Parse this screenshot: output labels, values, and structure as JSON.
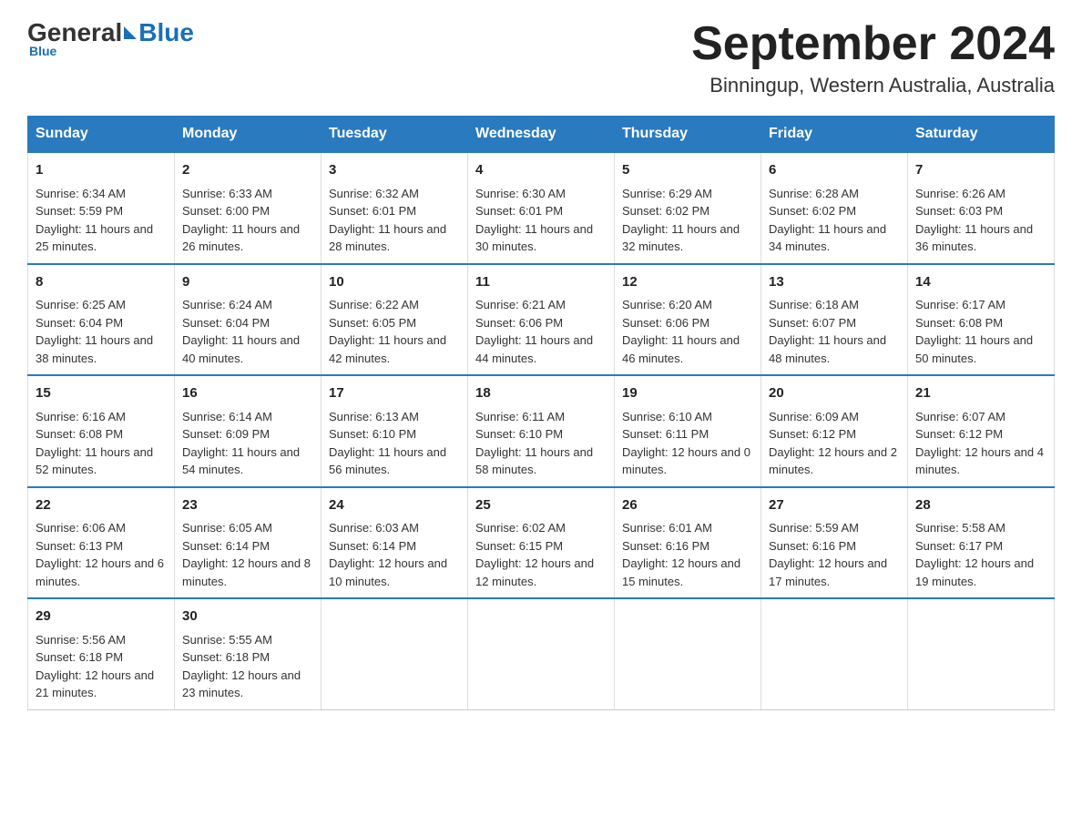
{
  "header": {
    "logo": {
      "general": "General",
      "blue": "Blue"
    },
    "title": "September 2024",
    "location": "Binningup, Western Australia, Australia"
  },
  "days_of_week": [
    "Sunday",
    "Monday",
    "Tuesday",
    "Wednesday",
    "Thursday",
    "Friday",
    "Saturday"
  ],
  "weeks": [
    [
      {
        "day": "1",
        "sunrise": "6:34 AM",
        "sunset": "5:59 PM",
        "daylight": "11 hours and 25 minutes."
      },
      {
        "day": "2",
        "sunrise": "6:33 AM",
        "sunset": "6:00 PM",
        "daylight": "11 hours and 26 minutes."
      },
      {
        "day": "3",
        "sunrise": "6:32 AM",
        "sunset": "6:01 PM",
        "daylight": "11 hours and 28 minutes."
      },
      {
        "day": "4",
        "sunrise": "6:30 AM",
        "sunset": "6:01 PM",
        "daylight": "11 hours and 30 minutes."
      },
      {
        "day": "5",
        "sunrise": "6:29 AM",
        "sunset": "6:02 PM",
        "daylight": "11 hours and 32 minutes."
      },
      {
        "day": "6",
        "sunrise": "6:28 AM",
        "sunset": "6:02 PM",
        "daylight": "11 hours and 34 minutes."
      },
      {
        "day": "7",
        "sunrise": "6:26 AM",
        "sunset": "6:03 PM",
        "daylight": "11 hours and 36 minutes."
      }
    ],
    [
      {
        "day": "8",
        "sunrise": "6:25 AM",
        "sunset": "6:04 PM",
        "daylight": "11 hours and 38 minutes."
      },
      {
        "day": "9",
        "sunrise": "6:24 AM",
        "sunset": "6:04 PM",
        "daylight": "11 hours and 40 minutes."
      },
      {
        "day": "10",
        "sunrise": "6:22 AM",
        "sunset": "6:05 PM",
        "daylight": "11 hours and 42 minutes."
      },
      {
        "day": "11",
        "sunrise": "6:21 AM",
        "sunset": "6:06 PM",
        "daylight": "11 hours and 44 minutes."
      },
      {
        "day": "12",
        "sunrise": "6:20 AM",
        "sunset": "6:06 PM",
        "daylight": "11 hours and 46 minutes."
      },
      {
        "day": "13",
        "sunrise": "6:18 AM",
        "sunset": "6:07 PM",
        "daylight": "11 hours and 48 minutes."
      },
      {
        "day": "14",
        "sunrise": "6:17 AM",
        "sunset": "6:08 PM",
        "daylight": "11 hours and 50 minutes."
      }
    ],
    [
      {
        "day": "15",
        "sunrise": "6:16 AM",
        "sunset": "6:08 PM",
        "daylight": "11 hours and 52 minutes."
      },
      {
        "day": "16",
        "sunrise": "6:14 AM",
        "sunset": "6:09 PM",
        "daylight": "11 hours and 54 minutes."
      },
      {
        "day": "17",
        "sunrise": "6:13 AM",
        "sunset": "6:10 PM",
        "daylight": "11 hours and 56 minutes."
      },
      {
        "day": "18",
        "sunrise": "6:11 AM",
        "sunset": "6:10 PM",
        "daylight": "11 hours and 58 minutes."
      },
      {
        "day": "19",
        "sunrise": "6:10 AM",
        "sunset": "6:11 PM",
        "daylight": "12 hours and 0 minutes."
      },
      {
        "day": "20",
        "sunrise": "6:09 AM",
        "sunset": "6:12 PM",
        "daylight": "12 hours and 2 minutes."
      },
      {
        "day": "21",
        "sunrise": "6:07 AM",
        "sunset": "6:12 PM",
        "daylight": "12 hours and 4 minutes."
      }
    ],
    [
      {
        "day": "22",
        "sunrise": "6:06 AM",
        "sunset": "6:13 PM",
        "daylight": "12 hours and 6 minutes."
      },
      {
        "day": "23",
        "sunrise": "6:05 AM",
        "sunset": "6:14 PM",
        "daylight": "12 hours and 8 minutes."
      },
      {
        "day": "24",
        "sunrise": "6:03 AM",
        "sunset": "6:14 PM",
        "daylight": "12 hours and 10 minutes."
      },
      {
        "day": "25",
        "sunrise": "6:02 AM",
        "sunset": "6:15 PM",
        "daylight": "12 hours and 12 minutes."
      },
      {
        "day": "26",
        "sunrise": "6:01 AM",
        "sunset": "6:16 PM",
        "daylight": "12 hours and 15 minutes."
      },
      {
        "day": "27",
        "sunrise": "5:59 AM",
        "sunset": "6:16 PM",
        "daylight": "12 hours and 17 minutes."
      },
      {
        "day": "28",
        "sunrise": "5:58 AM",
        "sunset": "6:17 PM",
        "daylight": "12 hours and 19 minutes."
      }
    ],
    [
      {
        "day": "29",
        "sunrise": "5:56 AM",
        "sunset": "6:18 PM",
        "daylight": "12 hours and 21 minutes."
      },
      {
        "day": "30",
        "sunrise": "5:55 AM",
        "sunset": "6:18 PM",
        "daylight": "12 hours and 23 minutes."
      },
      null,
      null,
      null,
      null,
      null
    ]
  ]
}
